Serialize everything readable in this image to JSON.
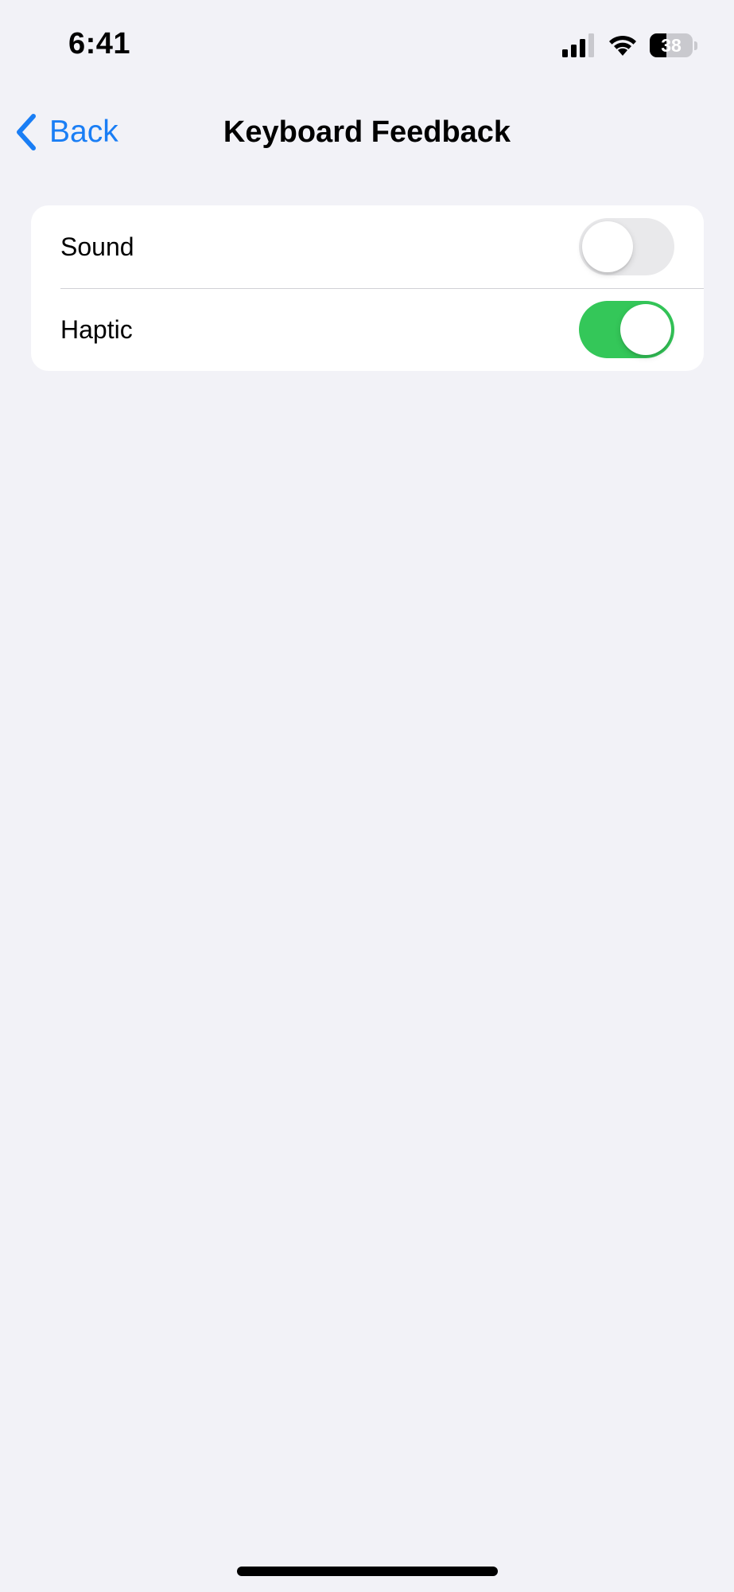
{
  "status_bar": {
    "time": "6:41",
    "battery_level": "38",
    "battery_fraction": 0.38,
    "icons": [
      "signal-icon",
      "wifi-icon",
      "battery-icon"
    ]
  },
  "nav": {
    "back_label": "Back",
    "back_icon": "chevron-left-icon",
    "title": "Keyboard Feedback"
  },
  "settings": {
    "rows": [
      {
        "label": "Sound",
        "enabled": false
      },
      {
        "label": "Haptic",
        "enabled": true
      }
    ]
  },
  "colors": {
    "accent": "#1a7ef5",
    "toggle_on": "#34c759",
    "toggle_off": "#e9e9eb",
    "background": "#f2f2f7"
  }
}
